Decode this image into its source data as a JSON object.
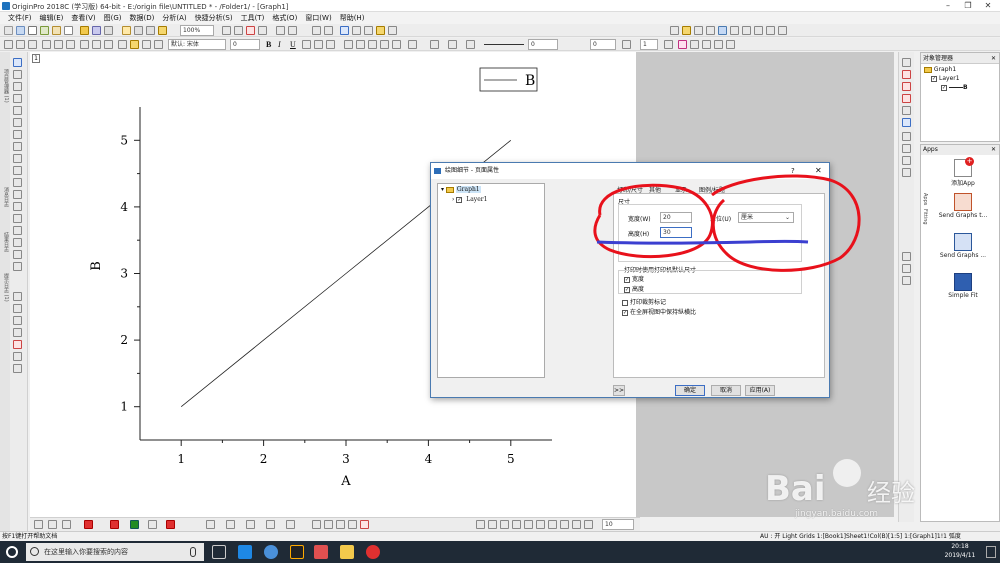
{
  "window": {
    "title": "OriginPro 2018C (学习版) 64-bit - E:/origin file\\UNTITLED * - /Folder1/ - [Graph1]",
    "controls": [
      "–",
      "❐",
      "✕"
    ]
  },
  "menu": [
    "文件(F)",
    "编辑(E)",
    "查看(V)",
    "图(G)",
    "数据(D)",
    "分析(A)",
    "快捷分析(S)",
    "工具(T)",
    "格式(O)",
    "窗口(W)",
    "帮助(H)"
  ],
  "toolbar": {
    "zoom": "100%",
    "font": "默认: 宋体",
    "font_size": "0",
    "bold": "B",
    "italic": "I",
    "underline": "U",
    "line_width": "0",
    "fill_value": "0",
    "size_value": "1"
  },
  "left_vtabs": [
    "项目管理器 (1)",
    "消息日志",
    "结果日志",
    "提示日志 (1)"
  ],
  "graph": {
    "layer_badge": "1",
    "legend_label": "B"
  },
  "chart_data": {
    "type": "line",
    "x": [
      1,
      2,
      3,
      4,
      5
    ],
    "series": [
      {
        "name": "B",
        "values": [
          1,
          2,
          3,
          4,
          5
        ]
      }
    ],
    "xlabel": "A",
    "ylabel": "B",
    "xticks": [
      "1",
      "2",
      "3",
      "4",
      "5"
    ],
    "yticks": [
      "1",
      "2",
      "3",
      "4",
      "5"
    ],
    "xlim": [
      0.5,
      5.5
    ],
    "ylim": [
      0.5,
      5.5
    ]
  },
  "dialog": {
    "title": "绘图细节 - 页面属性",
    "help": "?",
    "close": "✕",
    "tree": {
      "root": "Graph1",
      "child": "Layer1"
    },
    "tabs": [
      "打印/尺寸",
      "其他",
      "显示",
      "图例/标题"
    ],
    "size_group": "尺寸",
    "width_label": "宽度(W)",
    "width_value": "20",
    "height_label": "高度(H)",
    "height_value": "30",
    "unit_label": "单位(U)",
    "unit_value": "厘米",
    "print_group": "打印时使用打印机默认尺寸",
    "print_width": "宽度",
    "print_height": "高度",
    "crop_marks": "打印裁剪标记",
    "keep_ratio": "在全屏视图中保持纵横比",
    "expand": ">>",
    "ok": "确定",
    "cancel": "取消",
    "apply": "应用(A)"
  },
  "object_manager": {
    "title": "对象管理器",
    "graph": "Graph1",
    "layer": "Layer1",
    "plot": "B"
  },
  "apps": {
    "title": "Apps",
    "side_tabs": [
      "Apps",
      "Fitting"
    ],
    "items": [
      "添加App",
      "Send Graphs t...",
      "Send Graphs ...",
      "Simple Fit"
    ]
  },
  "status_bar": {
    "left": "按F1键打开帮助文档",
    "right": "AU : 开  Light Grids  1:[Book1]Sheet1!Col(B)[1:5]  1:[Graph1]1!1  弧度"
  },
  "bottom_toolbar": {
    "size": "10"
  },
  "taskbar": {
    "search_placeholder": "在这里输入你要搜索的内容",
    "time": "20:18",
    "date": "2019/4/11"
  },
  "watermark": {
    "brand": "Bai",
    "brand_cn": "经验",
    "url": "jingyan.baidu.com"
  },
  "colors": {
    "annotation_red": "#e8111b",
    "annotation_blue": "#3b3fd0",
    "workspace_gray": "#c8c8c8",
    "taskbar": "#1f2a36"
  }
}
